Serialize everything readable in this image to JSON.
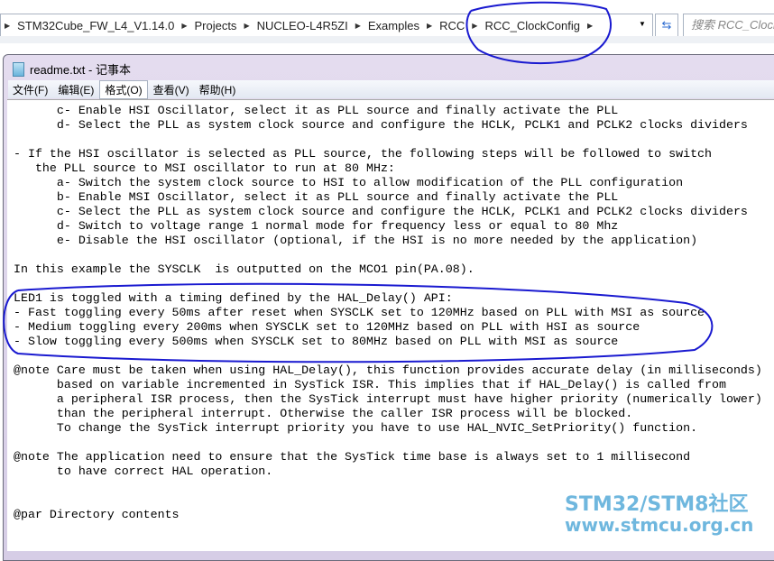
{
  "explorer": {
    "breadcrumb": [
      "STM32Cube_FW_L4_V1.14.0",
      "Projects",
      "NUCLEO-L4R5ZI",
      "Examples",
      "RCC",
      "RCC_ClockConfig"
    ],
    "search_placeholder": "搜索 RCC_ClockConfig",
    "refresh_icon": "refresh-icon"
  },
  "notepad": {
    "title": "readme.txt - 记事本",
    "menu": [
      "文件(F)",
      "编辑(E)",
      "格式(O)",
      "查看(V)",
      "帮助(H)"
    ],
    "lines": [
      "      c- Enable HSI Oscillator, select it as PLL source and finally activate the PLL",
      "      d- Select the PLL as system clock source and configure the HCLK, PCLK1 and PCLK2 clocks dividers",
      "",
      "- If the HSI oscillator is selected as PLL source, the following steps will be followed to switch",
      "   the PLL source to MSI oscillator to run at 80 MHz:",
      "      a- Switch the system clock source to HSI to allow modification of the PLL configuration",
      "      b- Enable MSI Oscillator, select it as PLL source and finally activate the PLL",
      "      c- Select the PLL as system clock source and configure the HCLK, PCLK1 and PCLK2 clocks dividers",
      "      d- Switch to voltage range 1 normal mode for frequency less or equal to 80 Mhz",
      "      e- Disable the HSI oscillator (optional, if the HSI is no more needed by the application)",
      "",
      "In this example the SYSCLK  is outputted on the MCO1 pin(PA.08).",
      "",
      "LED1 is toggled with a timing defined by the HAL_Delay() API:",
      "- Fast toggling every 50ms after reset when SYSCLK set to 120MHz based on PLL with MSI as source",
      "- Medium toggling every 200ms when SYSCLK set to 120MHz based on PLL with HSI as source",
      "- Slow toggling every 500ms when SYSCLK set to 80MHz based on PLL with MSI as source",
      "",
      "@note Care must be taken when using HAL_Delay(), this function provides accurate delay (in milliseconds)",
      "      based on variable incremented in SysTick ISR. This implies that if HAL_Delay() is called from",
      "      a peripheral ISR process, then the SysTick interrupt must have higher priority (numerically lower)",
      "      than the peripheral interrupt. Otherwise the caller ISR process will be blocked.",
      "      To change the SysTick interrupt priority you have to use HAL_NVIC_SetPriority() function.",
      "",
      "@note The application need to ensure that the SysTick time base is always set to 1 millisecond",
      "      to have correct HAL operation.",
      "",
      "",
      "@par Directory contents"
    ]
  },
  "watermark": {
    "line1": "STM32/STM8社区",
    "line2": "www.stmcu.org.cn"
  },
  "annotation_color": "#1a1ad0"
}
